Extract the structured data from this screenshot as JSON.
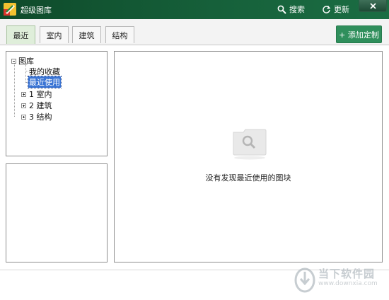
{
  "window": {
    "title": "超级图库"
  },
  "titlebar": {
    "search_label": "搜索",
    "update_label": "更新"
  },
  "tabs": [
    {
      "label": "最近",
      "active": true
    },
    {
      "label": "室内",
      "active": false
    },
    {
      "label": "建筑",
      "active": false
    },
    {
      "label": "结构",
      "active": false
    }
  ],
  "add_button": {
    "label": "+ 添加定制"
  },
  "tree": {
    "root": "图库",
    "children": [
      {
        "label": "我的收藏"
      },
      {
        "label": "最近使用",
        "selected": true
      },
      {
        "label": "1 室内"
      },
      {
        "label": "2 建筑"
      },
      {
        "label": "3 结构"
      }
    ]
  },
  "main": {
    "empty_message": "没有发现最近使用的图块"
  },
  "watermark": {
    "name": "当下软件园",
    "url": "www.downxia.com"
  },
  "colors": {
    "titlebar": "#16603a",
    "add_button": "#2f8f5c",
    "selection": "#3a74d4",
    "active_tab": "#dfeeda"
  }
}
